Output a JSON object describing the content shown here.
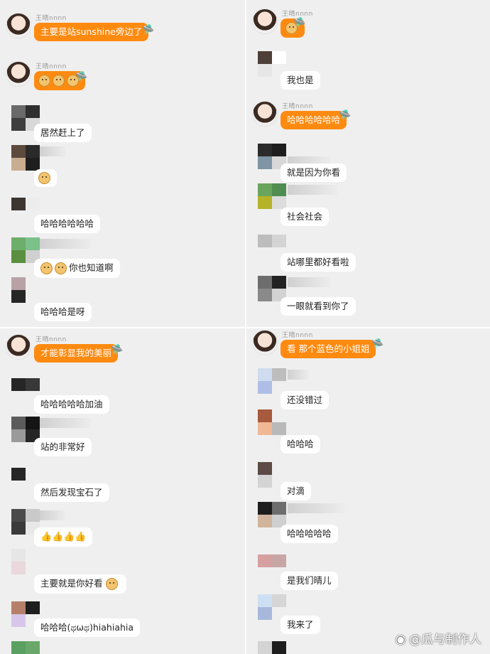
{
  "panel_tl": {
    "messages": [
      {
        "name": "王晴nnnn",
        "text": "主要是站sunshine旁边了",
        "style": "orange"
      },
      {
        "name": "王晴nnnn",
        "text": "",
        "style": "orange",
        "emoji_count": 3
      },
      {
        "text": "居然赶上了",
        "style": "white"
      },
      {
        "text": "",
        "style": "white",
        "emoji_count": 1
      },
      {
        "text": "哈哈哈哈哈哈",
        "style": "white"
      },
      {
        "text": "你也知道啊",
        "style": "white",
        "emoji_count": 2
      },
      {
        "text": "哈哈哈是呀",
        "style": "white"
      }
    ]
  },
  "panel_tr": {
    "messages": [
      {
        "name": "王晴nnnn",
        "text": "",
        "style": "orange",
        "emoji_count": 1
      },
      {
        "text": "我也是",
        "style": "white"
      },
      {
        "name": "王晴nnnn",
        "text": "哈哈哈哈哈哈",
        "style": "orange"
      },
      {
        "text": "就是因为你看",
        "style": "white"
      },
      {
        "text": "社会社会",
        "style": "white"
      },
      {
        "text": "站哪里都好看啦",
        "style": "white"
      },
      {
        "text": "一眼就看到你了",
        "style": "white"
      }
    ]
  },
  "panel_bl": {
    "messages": [
      {
        "name": "王晴nnnn",
        "text": "才能彰显我的美丽",
        "style": "orange"
      },
      {
        "text": "哈哈哈哈哈加油",
        "style": "white"
      },
      {
        "text": "站的非常好",
        "style": "white"
      },
      {
        "text": "然后发现宝石了",
        "style": "white"
      },
      {
        "text": "",
        "style": "white",
        "thumbs": 4
      },
      {
        "text": "主要就是你好看",
        "style": "white",
        "emoji_count": 1
      },
      {
        "text": "哈哈哈(ಥωಥ)hiahiahia",
        "style": "white"
      }
    ]
  },
  "panel_br": {
    "messages": [
      {
        "name": "王晴nnnn",
        "text": "看 那个蓝色的小姐姐",
        "style": "orange"
      },
      {
        "text": "还没错过",
        "style": "white"
      },
      {
        "text": "哈哈哈",
        "style": "white"
      },
      {
        "text": "对滴",
        "style": "white"
      },
      {
        "text": "哈哈哈哈哈",
        "style": "white"
      },
      {
        "text": "是我们晴儿",
        "style": "white"
      },
      {
        "text": "我来了",
        "style": "white"
      }
    ]
  },
  "watermark": {
    "text": "@瓜与制作人"
  },
  "icons": {
    "ufo": "ufo-icon",
    "dog": "dog-emoji-icon",
    "thumb": "thumbs-up-icon",
    "weibo": "weibo-logo-icon"
  },
  "colors": {
    "bubble_orange": "#ff8a10",
    "panel_bg": "#efefef",
    "bubble_white": "#ffffff"
  }
}
